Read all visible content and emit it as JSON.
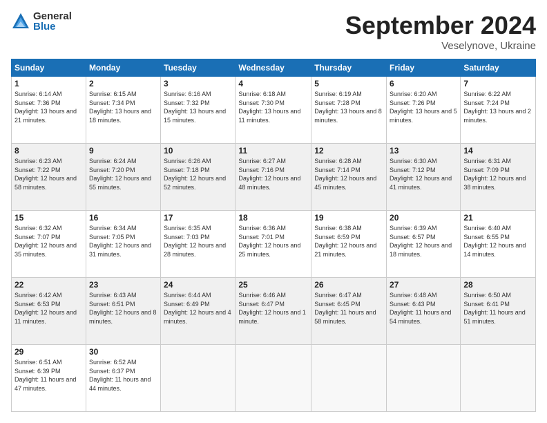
{
  "logo": {
    "general": "General",
    "blue": "Blue"
  },
  "title": "September 2024",
  "location": "Veselynove, Ukraine",
  "days_header": [
    "Sunday",
    "Monday",
    "Tuesday",
    "Wednesday",
    "Thursday",
    "Friday",
    "Saturday"
  ],
  "weeks": [
    [
      {
        "num": "1",
        "sunrise": "6:14 AM",
        "sunset": "7:36 PM",
        "daylight": "13 hours and 21 minutes."
      },
      {
        "num": "2",
        "sunrise": "6:15 AM",
        "sunset": "7:34 PM",
        "daylight": "13 hours and 18 minutes."
      },
      {
        "num": "3",
        "sunrise": "6:16 AM",
        "sunset": "7:32 PM",
        "daylight": "13 hours and 15 minutes."
      },
      {
        "num": "4",
        "sunrise": "6:18 AM",
        "sunset": "7:30 PM",
        "daylight": "13 hours and 11 minutes."
      },
      {
        "num": "5",
        "sunrise": "6:19 AM",
        "sunset": "7:28 PM",
        "daylight": "13 hours and 8 minutes."
      },
      {
        "num": "6",
        "sunrise": "6:20 AM",
        "sunset": "7:26 PM",
        "daylight": "13 hours and 5 minutes."
      },
      {
        "num": "7",
        "sunrise": "6:22 AM",
        "sunset": "7:24 PM",
        "daylight": "13 hours and 2 minutes."
      }
    ],
    [
      {
        "num": "8",
        "sunrise": "6:23 AM",
        "sunset": "7:22 PM",
        "daylight": "12 hours and 58 minutes."
      },
      {
        "num": "9",
        "sunrise": "6:24 AM",
        "sunset": "7:20 PM",
        "daylight": "12 hours and 55 minutes."
      },
      {
        "num": "10",
        "sunrise": "6:26 AM",
        "sunset": "7:18 PM",
        "daylight": "12 hours and 52 minutes."
      },
      {
        "num": "11",
        "sunrise": "6:27 AM",
        "sunset": "7:16 PM",
        "daylight": "12 hours and 48 minutes."
      },
      {
        "num": "12",
        "sunrise": "6:28 AM",
        "sunset": "7:14 PM",
        "daylight": "12 hours and 45 minutes."
      },
      {
        "num": "13",
        "sunrise": "6:30 AM",
        "sunset": "7:12 PM",
        "daylight": "12 hours and 41 minutes."
      },
      {
        "num": "14",
        "sunrise": "6:31 AM",
        "sunset": "7:09 PM",
        "daylight": "12 hours and 38 minutes."
      }
    ],
    [
      {
        "num": "15",
        "sunrise": "6:32 AM",
        "sunset": "7:07 PM",
        "daylight": "12 hours and 35 minutes."
      },
      {
        "num": "16",
        "sunrise": "6:34 AM",
        "sunset": "7:05 PM",
        "daylight": "12 hours and 31 minutes."
      },
      {
        "num": "17",
        "sunrise": "6:35 AM",
        "sunset": "7:03 PM",
        "daylight": "12 hours and 28 minutes."
      },
      {
        "num": "18",
        "sunrise": "6:36 AM",
        "sunset": "7:01 PM",
        "daylight": "12 hours and 25 minutes."
      },
      {
        "num": "19",
        "sunrise": "6:38 AM",
        "sunset": "6:59 PM",
        "daylight": "12 hours and 21 minutes."
      },
      {
        "num": "20",
        "sunrise": "6:39 AM",
        "sunset": "6:57 PM",
        "daylight": "12 hours and 18 minutes."
      },
      {
        "num": "21",
        "sunrise": "6:40 AM",
        "sunset": "6:55 PM",
        "daylight": "12 hours and 14 minutes."
      }
    ],
    [
      {
        "num": "22",
        "sunrise": "6:42 AM",
        "sunset": "6:53 PM",
        "daylight": "12 hours and 11 minutes."
      },
      {
        "num": "23",
        "sunrise": "6:43 AM",
        "sunset": "6:51 PM",
        "daylight": "12 hours and 8 minutes."
      },
      {
        "num": "24",
        "sunrise": "6:44 AM",
        "sunset": "6:49 PM",
        "daylight": "12 hours and 4 minutes."
      },
      {
        "num": "25",
        "sunrise": "6:46 AM",
        "sunset": "6:47 PM",
        "daylight": "12 hours and 1 minute."
      },
      {
        "num": "26",
        "sunrise": "6:47 AM",
        "sunset": "6:45 PM",
        "daylight": "11 hours and 58 minutes."
      },
      {
        "num": "27",
        "sunrise": "6:48 AM",
        "sunset": "6:43 PM",
        "daylight": "11 hours and 54 minutes."
      },
      {
        "num": "28",
        "sunrise": "6:50 AM",
        "sunset": "6:41 PM",
        "daylight": "11 hours and 51 minutes."
      }
    ],
    [
      {
        "num": "29",
        "sunrise": "6:51 AM",
        "sunset": "6:39 PM",
        "daylight": "11 hours and 47 minutes."
      },
      {
        "num": "30",
        "sunrise": "6:52 AM",
        "sunset": "6:37 PM",
        "daylight": "11 hours and 44 minutes."
      },
      null,
      null,
      null,
      null,
      null
    ]
  ]
}
